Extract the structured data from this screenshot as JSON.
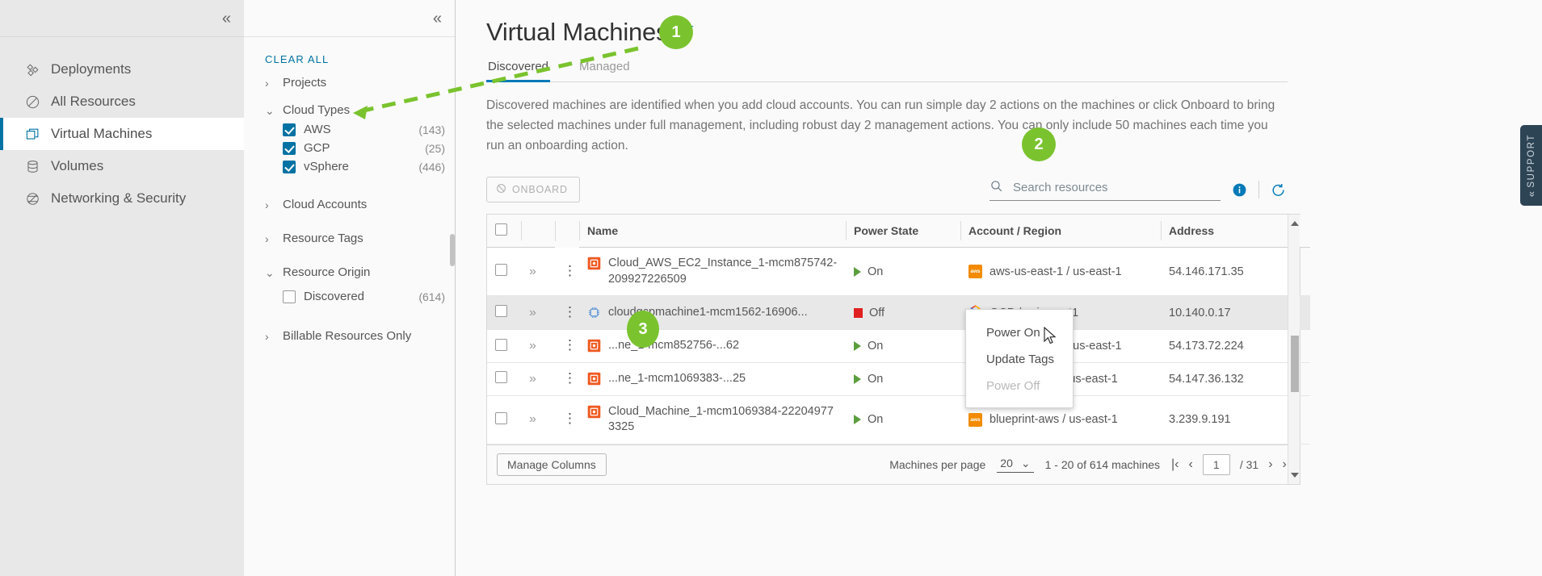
{
  "nav": {
    "collapse_icon": "double-chevron-left-icon",
    "items": [
      {
        "label": "Deployments",
        "icon": "deployments-icon",
        "active": false
      },
      {
        "label": "All Resources",
        "icon": "all-resources-icon",
        "active": false
      },
      {
        "label": "Virtual Machines",
        "icon": "virtual-machines-icon",
        "active": true
      },
      {
        "label": "Volumes",
        "icon": "volumes-icon",
        "active": false
      },
      {
        "label": "Networking & Security",
        "icon": "networking-security-icon",
        "active": false
      }
    ]
  },
  "filters": {
    "collapse_icon": "double-chevron-left-icon",
    "clear_all": "CLEAR ALL",
    "groups": [
      {
        "label": "Projects",
        "expanded": false,
        "items": []
      },
      {
        "label": "Cloud Types",
        "expanded": true,
        "items": [
          {
            "label": "AWS",
            "count": "(143)",
            "checked": true
          },
          {
            "label": "GCP",
            "count": "(25)",
            "checked": true
          },
          {
            "label": "vSphere",
            "count": "(446)",
            "checked": true
          }
        ]
      },
      {
        "label": "Cloud Accounts",
        "expanded": false,
        "items": []
      },
      {
        "label": "Resource Tags",
        "expanded": false,
        "items": []
      },
      {
        "label": "Resource Origin",
        "expanded": true,
        "items": [
          {
            "label": "Discovered",
            "count": "(614)",
            "checked": false
          }
        ]
      },
      {
        "label": "Billable Resources Only",
        "expanded": false,
        "items": []
      }
    ]
  },
  "page": {
    "title": "Virtual Machines",
    "filter_icon": "funnel-icon",
    "tabs": [
      {
        "label": "Discovered",
        "active": true
      },
      {
        "label": "Managed",
        "active": false
      }
    ],
    "description": "Discovered machines are identified when you add cloud accounts. You can run simple day 2 actions on the machines or click Onboard to bring the selected machines under full management, including robust day 2 management actions. You can only include 50 machines each time you run an onboarding action."
  },
  "toolbar": {
    "onboard_label": "ONBOARD",
    "onboard_icon": "blocked-icon",
    "search_placeholder": "Search resources",
    "search_value": "",
    "search_icon": "search-icon",
    "info_icon": "info-circle-icon",
    "refresh_icon": "refresh-icon"
  },
  "table": {
    "columns": [
      "Name",
      "Power State",
      "Account / Region",
      "Address"
    ],
    "rows": [
      {
        "name": "Cloud_AWS_EC2_Instance_1-mcm875742-209927226509",
        "icon": "aws-instance-icon",
        "power": "On",
        "power_state": "on",
        "account": "aws-us-east-1 / us-east-1",
        "account_icon": "aws-icon",
        "address": "54.146.171.35",
        "selected": false
      },
      {
        "name": "cloudgcpmachine1-mcm1562-16906...",
        "icon": "gcp-instance-icon",
        "power": "Off",
        "power_state": "off",
        "account": "GCP / asia-east1",
        "account_icon": "gcp-icon",
        "address": "10.140.0.17",
        "selected": true
      },
      {
        "name": "...ne_1-mcm852756-...62",
        "icon": "aws-instance-icon",
        "power": "On",
        "power_state": "on",
        "account": "aws-us-east-1 / us-east-1",
        "account_icon": "aws-icon",
        "address": "54.173.72.224",
        "selected": false
      },
      {
        "name": "...ne_1-mcm1069383-...25",
        "icon": "aws-instance-icon",
        "power": "On",
        "power_state": "on",
        "account": "blueprint-aws / us-east-1",
        "account_icon": "aws-icon",
        "address": "54.147.36.132",
        "selected": false
      },
      {
        "name": "Cloud_Machine_1-mcm1069384-222049773325",
        "icon": "aws-instance-icon",
        "power": "On",
        "power_state": "on",
        "account": "blueprint-aws / us-east-1",
        "account_icon": "aws-icon",
        "address": "3.239.9.191",
        "selected": false
      }
    ]
  },
  "footer": {
    "manage_columns": "Manage Columns",
    "per_page_label": "Machines per page",
    "per_page_value": "20",
    "range_label": "1 - 20 of 614 machines",
    "page_value": "1",
    "page_total": "/ 31",
    "first_icon": "first-page-icon",
    "prev_icon": "prev-page-icon",
    "next_icon": "next-page-icon",
    "last_icon": "last-page-icon"
  },
  "context_menu": {
    "items": [
      {
        "label": "Power On",
        "disabled": false
      },
      {
        "label": "Update Tags",
        "disabled": false
      },
      {
        "label": "Power Off",
        "disabled": true
      }
    ]
  },
  "annotations": {
    "badges": [
      {
        "num": "1"
      },
      {
        "num": "2"
      },
      {
        "num": "3"
      }
    ],
    "arrow_color": "#7ac32e"
  },
  "support": {
    "label": "SUPPORT",
    "chevron_icon": "double-chevron-left-icon"
  }
}
